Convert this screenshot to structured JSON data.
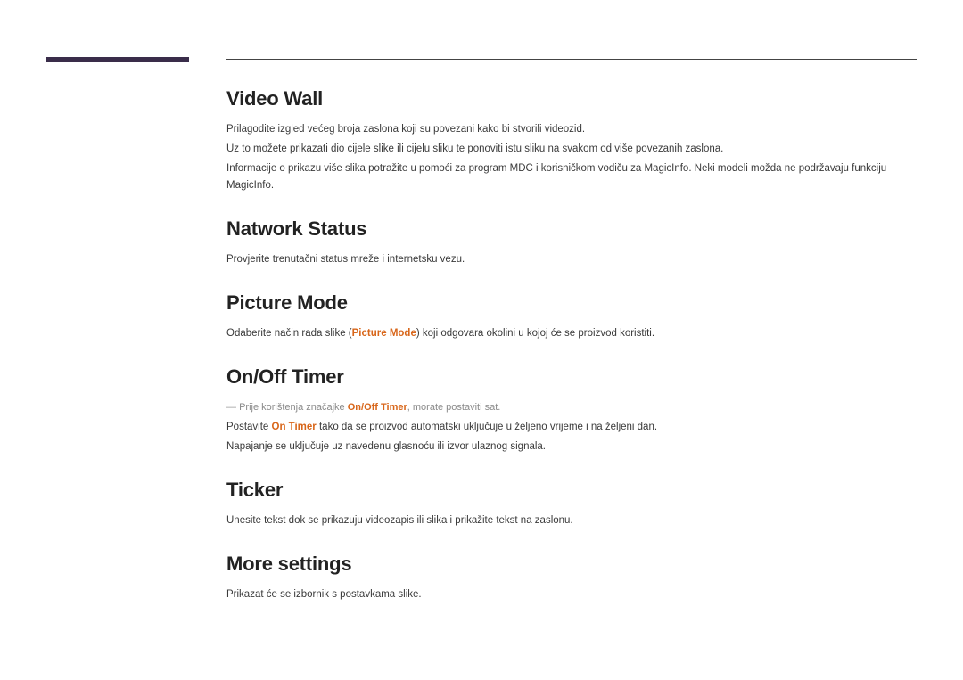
{
  "sections": {
    "videoWall": {
      "heading": "Video Wall",
      "p1": "Prilagodite izgled većeg broja zaslona koji su povezani kako bi stvorili videozid.",
      "p2": "Uz to možete prikazati dio cijele slike ili cijelu sliku te ponoviti istu sliku na svakom od više povezanih zaslona.",
      "p3": "Informacije o prikazu više slika potražite u pomoći za program MDC i korisničkom vodiču za MagicInfo. Neki modeli možda ne podržavaju funkciju MagicInfo."
    },
    "networkStatus": {
      "heading": "Natwork Status",
      "p1": "Provjerite trenutačni status mreže i internetsku vezu."
    },
    "pictureMode": {
      "heading": "Picture Mode",
      "p1_before": "Odaberite način rada slike (",
      "p1_bold": "Picture Mode",
      "p1_after": ") koji odgovara okolini u kojoj će se proizvod koristiti."
    },
    "onOffTimer": {
      "heading": "On/Off Timer",
      "note_before": "Prije korištenja značajke ",
      "note_bold": "On/Off Timer",
      "note_after": ", morate postaviti sat.",
      "p1_before": "Postavite ",
      "p1_bold": "On Timer",
      "p1_after": " tako da se proizvod automatski uključuje u željeno vrijeme i na željeni dan.",
      "p2": "Napajanje se uključuje uz navedenu glasnoću ili izvor ulaznog signala."
    },
    "ticker": {
      "heading": "Ticker",
      "p1": "Unesite tekst dok se prikazuju videozapis ili slika i prikažite tekst na zaslonu."
    },
    "moreSettings": {
      "heading": "More settings",
      "p1": "Prikazat će se izbornik s postavkama slike."
    }
  }
}
